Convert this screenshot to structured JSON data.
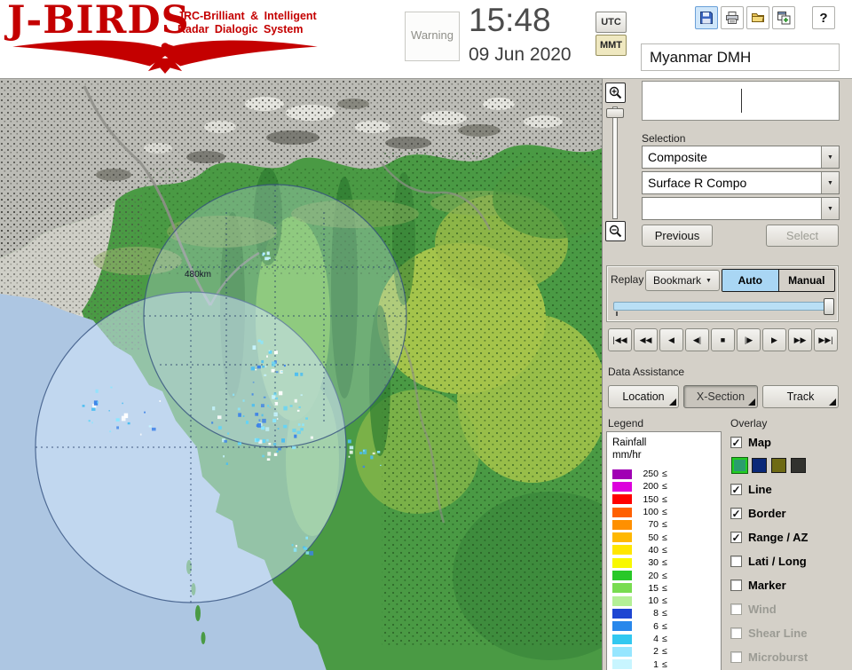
{
  "header": {
    "logo": {
      "title": "J-BIRDS",
      "subtitle_line1": "JRC-Brilliant & Intelligent",
      "subtitle_line2": "Radar Dialogic System"
    },
    "warning_label": "Warning",
    "clock": {
      "time": "15:48",
      "date": "09 Jun 2020"
    },
    "timezone": {
      "utc_label": "UTC",
      "mmt_label": "MMT",
      "selected": "MMT"
    },
    "toolbar_icons": [
      "save",
      "print",
      "open-folder",
      "add-window",
      "help"
    ],
    "help_glyph": "?",
    "station_name": "Myanmar DMH"
  },
  "map": {
    "range_label": "480km"
  },
  "glyphs": {
    "dropdown_arrow": "▼",
    "check": "✓"
  },
  "sidebar": {
    "selection": {
      "label": "Selection",
      "dropdowns": [
        "Composite",
        "Surface R Compo",
        ""
      ],
      "previous_label": "Previous",
      "select_label": "Select"
    },
    "replay": {
      "label": "Replay",
      "bookmark_label": "Bookmark",
      "auto_label": "Auto",
      "manual_label": "Manual",
      "mode_selected": "Auto",
      "playback_buttons": [
        "|◀◀",
        "◀◀",
        "◀",
        "◀|",
        "■",
        "|▶",
        "▶",
        "▶▶",
        "▶▶|"
      ]
    },
    "data_assistance": {
      "label": "Data Assistance",
      "buttons": [
        {
          "label": "Location",
          "pressed": false
        },
        {
          "label": "X-Section",
          "pressed": true
        },
        {
          "label": "Track",
          "pressed": false
        }
      ]
    },
    "legend": {
      "label": "Legend",
      "unit_line1": "Rainfall",
      "unit_line2": "mm/hr",
      "suffix": "≤",
      "rows": [
        {
          "value": "250",
          "color": "#a000b4"
        },
        {
          "value": "200",
          "color": "#dc00dc"
        },
        {
          "value": "150",
          "color": "#ff0000"
        },
        {
          "value": "100",
          "color": "#ff6000"
        },
        {
          "value": "70",
          "color": "#ff9000"
        },
        {
          "value": "50",
          "color": "#ffb800"
        },
        {
          "value": "40",
          "color": "#ffe600"
        },
        {
          "value": "30",
          "color": "#f8f800"
        },
        {
          "value": "20",
          "color": "#28c828"
        },
        {
          "value": "15",
          "color": "#78dc50"
        },
        {
          "value": "10",
          "color": "#b4f096"
        },
        {
          "value": "8",
          "color": "#1e46d2"
        },
        {
          "value": "6",
          "color": "#2887eb"
        },
        {
          "value": "4",
          "color": "#32c8f0"
        },
        {
          "value": "2",
          "color": "#96e6ff"
        },
        {
          "value": "1",
          "color": "#c8f5ff"
        }
      ]
    },
    "overlay": {
      "label": "Overlay",
      "items": [
        {
          "label": "Map",
          "checked": true,
          "enabled": true
        },
        {
          "label": "Line",
          "checked": true,
          "enabled": true
        },
        {
          "label": "Border",
          "checked": true,
          "enabled": true
        },
        {
          "label": "Range / AZ",
          "checked": true,
          "enabled": true
        },
        {
          "label": "Lati / Long",
          "checked": false,
          "enabled": true
        },
        {
          "label": "Marker",
          "checked": false,
          "enabled": true
        },
        {
          "label": "Wind",
          "checked": false,
          "enabled": false
        },
        {
          "label": "Shear Line",
          "checked": false,
          "enabled": false
        },
        {
          "label": "Microburst",
          "checked": false,
          "enabled": false
        }
      ],
      "map_swatches": [
        {
          "color": "#2a9d6e",
          "selected": true
        },
        {
          "color": "#0a2878",
          "selected": false
        },
        {
          "color": "#6e6a14",
          "selected": false
        },
        {
          "color": "#32322e",
          "selected": false
        }
      ]
    }
  },
  "colors": {
    "logo_red": "#c40000",
    "sidebar_bg": "#d4d0c8",
    "accent_blue": "#a9d6f4",
    "sea": "#adc6e2",
    "radar_disc": "#d2e6fa"
  }
}
